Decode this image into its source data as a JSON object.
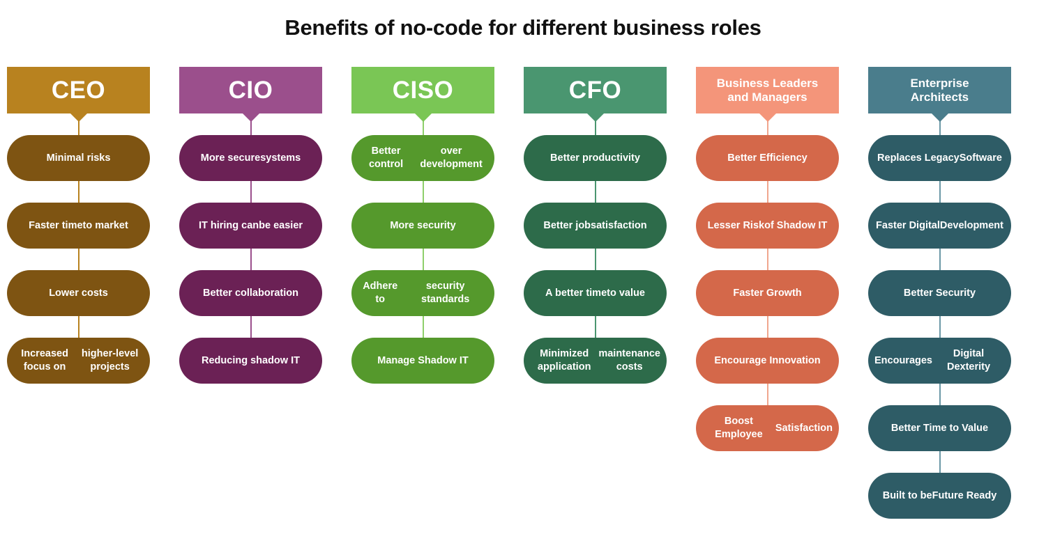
{
  "page": {
    "title": "Benefits of no-code for different business roles",
    "background": "#FFFFFF"
  },
  "chart_data": {
    "type": "table",
    "title": "Benefits of no-code for different business roles",
    "xlabel": "",
    "ylabel": "",
    "layout": "six parallel vertical flow columns, each headed by a colored role banner with a downward notch, followed by a vertical connector line linking rounded pill items",
    "categories": [
      "CEO",
      "CIO",
      "CISO",
      "CFO",
      "Business Leaders and Managers",
      "Enterprise Architects"
    ],
    "values": [
      4,
      4,
      4,
      4,
      5,
      6
    ],
    "series": [
      {
        "name": "CEO",
        "values": [
          "Minimal risks",
          "Faster time to market",
          "Lower costs",
          "Increased focus on higher-level projects"
        ]
      },
      {
        "name": "CIO",
        "values": [
          "More secure systems",
          "IT hiring can be easier",
          "Better collaboration",
          "Reducing shadow IT"
        ]
      },
      {
        "name": "CISO",
        "values": [
          "Better control over development",
          "More security",
          "Adhere to security standards",
          "Manage Shadow IT"
        ]
      },
      {
        "name": "CFO",
        "values": [
          "Better productivity",
          "Better job satisfaction",
          "A better time to value",
          "Minimized application maintenance costs"
        ]
      },
      {
        "name": "Business Leaders and Managers",
        "values": [
          "Better Efficiency",
          "Lesser Risk of Shadow IT",
          "Faster Growth",
          "Encourage Innovation",
          "Boost Employee Satisfaction"
        ]
      },
      {
        "name": "Enterprise Architects",
        "values": [
          "Replaces Legacy Software",
          "Faster Digital Development",
          "Better Security",
          "Encourages Digital Dexterity",
          "Better Time to Value",
          "Built to be Future Ready"
        ]
      }
    ]
  },
  "columns": [
    {
      "id": "ceo",
      "header": "CEO",
      "header_size": "big",
      "header_color": "#B8821F",
      "pill_color": "#7E5412",
      "line_color": "#B8821F",
      "items": [
        {
          "line1": "Minimal risks",
          "line2": ""
        },
        {
          "line1": "Faster time",
          "line2": "to market"
        },
        {
          "line1": "Lower costs",
          "line2": ""
        },
        {
          "line1": "Increased focus on",
          "line2": "higher-level projects"
        }
      ]
    },
    {
      "id": "cio",
      "header": "CIO",
      "header_size": "big",
      "header_color": "#9B4F8C",
      "pill_color": "#6B2155",
      "line_color": "#9B4F8C",
      "items": [
        {
          "line1": "More secure",
          "line2": "systems"
        },
        {
          "line1": "IT hiring can",
          "line2": "be easier"
        },
        {
          "line1": "Better collaboration",
          "line2": ""
        },
        {
          "line1": "Reducing shadow IT",
          "line2": ""
        }
      ]
    },
    {
      "id": "ciso",
      "header": "CISO",
      "header_size": "big",
      "header_color": "#7AC655",
      "pill_color": "#55992C",
      "line_color": "#8ECF6B",
      "items": [
        {
          "line1": "Better control",
          "line2": "over development"
        },
        {
          "line1": "More security",
          "line2": ""
        },
        {
          "line1": "Adhere to",
          "line2": "security standards"
        },
        {
          "line1": "Manage Shadow IT",
          "line2": ""
        }
      ]
    },
    {
      "id": "cfo",
      "header": "CFO",
      "header_size": "big",
      "header_color": "#4A9670",
      "pill_color": "#2D6B4A",
      "line_color": "#4A9670",
      "items": [
        {
          "line1": "Better productivity",
          "line2": ""
        },
        {
          "line1": "Better job",
          "line2": "satisfaction"
        },
        {
          "line1": "A better time",
          "line2": "to value"
        },
        {
          "line1": "Minimized application",
          "line2": "maintenance costs"
        }
      ]
    },
    {
      "id": "business-leaders",
      "header": "Business Leaders and Managers",
      "header_line1": "Business Leaders",
      "header_line2": "and Managers",
      "header_size": "small",
      "header_color": "#F4957A",
      "pill_color": "#D4684A",
      "line_color": "#F0A68E",
      "items": [
        {
          "line1": "Better Efficiency",
          "line2": ""
        },
        {
          "line1": "Lesser Risk",
          "line2": "of Shadow IT"
        },
        {
          "line1": "Faster Growth",
          "line2": ""
        },
        {
          "line1": "Encourage Innovation",
          "line2": ""
        },
        {
          "line1": "Boost Employee",
          "line2": "Satisfaction"
        }
      ]
    },
    {
      "id": "enterprise-architects",
      "header": "Enterprise Architects",
      "header_line1": "Enterprise",
      "header_line2": "Architects",
      "header_size": "small",
      "header_color": "#4A7D8C",
      "pill_color": "#2E5C66",
      "line_color": "#6B98A6",
      "items": [
        {
          "line1": "Replaces Legacy",
          "line2": "Software"
        },
        {
          "line1": "Faster Digital",
          "line2": "Development"
        },
        {
          "line1": "Better Security",
          "line2": ""
        },
        {
          "line1": "Encourages",
          "line2": "Digital Dexterity"
        },
        {
          "line1": "Better Time to Value",
          "line2": ""
        },
        {
          "line1": "Built to be",
          "line2": "Future Ready"
        }
      ]
    }
  ]
}
